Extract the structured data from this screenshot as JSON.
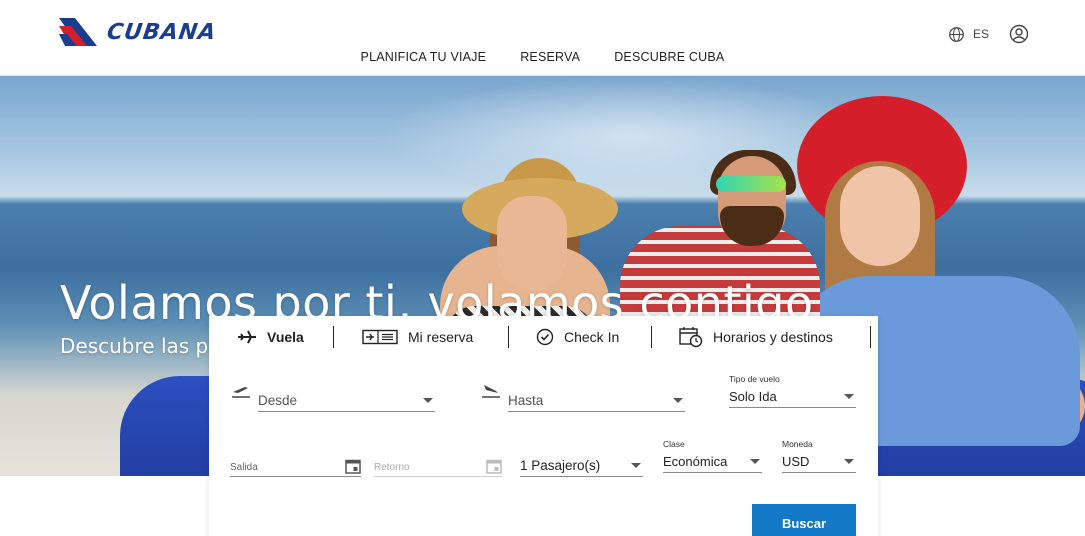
{
  "brand": {
    "name": "CUBANA",
    "colors": {
      "navy": "#1b3d8f",
      "red": "#d41f2a",
      "accent": "#1378c6"
    }
  },
  "nav": {
    "items": [
      {
        "label": "PLANIFICA TU VIAJE"
      },
      {
        "label": "RESERVA"
      },
      {
        "label": "DESCUBRE CUBA"
      }
    ]
  },
  "header": {
    "language": "ES",
    "icons": {
      "language": "globe-icon",
      "account": "user-icon"
    }
  },
  "hero": {
    "title": "Volamos por ti, volamos contigo",
    "subtitle": "Descubre las playas de Cuba"
  },
  "booking": {
    "tabs": [
      {
        "label": "Vuela",
        "icon": "plane-icon",
        "active": true
      },
      {
        "label": "Mi reserva",
        "icon": "ticket-icon",
        "active": false
      },
      {
        "label": "Check In",
        "icon": "check-circle-icon",
        "active": false
      },
      {
        "label": "Horarios y destinos",
        "icon": "calendar-clock-icon",
        "active": false
      }
    ],
    "from": {
      "placeholder": "Desde"
    },
    "to": {
      "placeholder": "Hasta"
    },
    "trip_type": {
      "label": "Tipo de vuelo",
      "value": "Solo Ida"
    },
    "departure": {
      "placeholder": "Salida"
    },
    "return": {
      "placeholder": "Retorno"
    },
    "passengers": {
      "value": "1 Pasajero(s)"
    },
    "cabin": {
      "label": "Clase",
      "value": "Económica"
    },
    "currency": {
      "label": "Moneda",
      "value": "USD"
    },
    "search_label": "Buscar"
  }
}
